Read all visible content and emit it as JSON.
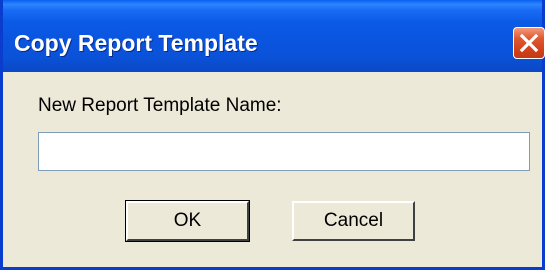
{
  "window": {
    "title": "Copy Report Template",
    "close_icon": "close-icon"
  },
  "form": {
    "label": "New Report Template Name:",
    "name_value": "",
    "name_placeholder": ""
  },
  "buttons": {
    "ok_label": "OK",
    "cancel_label": "Cancel"
  },
  "colors": {
    "titlebar": "#0a55e0",
    "dialog_bg": "#ece9d8",
    "close_button": "#d0401b"
  }
}
